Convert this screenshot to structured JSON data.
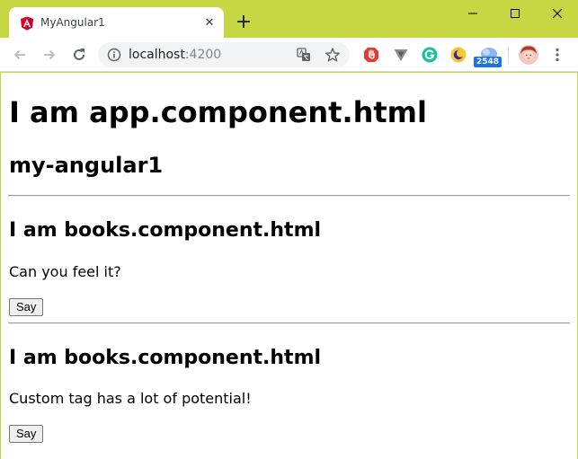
{
  "browser": {
    "tab_title": "MyAngular1",
    "tab_close_glyph": "✕",
    "new_tab_glyph": "+",
    "url_host": "localhost",
    "url_port": ":4200",
    "extension_badge": "2548"
  },
  "page": {
    "app_heading": "I am app.component.html",
    "app_subtitle": "my-angular1",
    "books": [
      {
        "heading": "I am books.component.html",
        "text": "Can you feel it?",
        "button_label": "Say"
      },
      {
        "heading": "I am books.component.html",
        "text": "Custom tag has a lot of potential!",
        "button_label": "Say"
      }
    ]
  },
  "colors": {
    "frame": "#c6d743",
    "angular_red": "#dd0031",
    "badge_blue": "#1a73e8"
  },
  "icons": [
    "angular-logo-icon",
    "close-icon",
    "plus-icon",
    "minimize-icon",
    "maximize-icon",
    "close-window-icon",
    "back-icon",
    "forward-icon",
    "reload-icon",
    "info-icon",
    "translate-icon",
    "star-icon",
    "opera-adblock-icon",
    "v-extension-icon",
    "grammarly-icon",
    "moon-icon",
    "weather-icon",
    "avatar",
    "menu-icon"
  ]
}
